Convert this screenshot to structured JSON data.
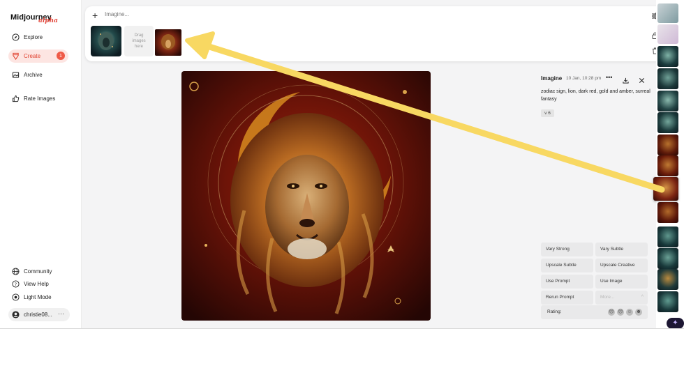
{
  "brand": {
    "name": "Midjourney",
    "sub": "alpha"
  },
  "nav": {
    "explore": "Explore",
    "create": "Create",
    "create_badge": "1",
    "archive": "Archive",
    "rate_images": "Rate Images",
    "community": "Community",
    "view_help": "View Help",
    "light_mode": "Light Mode"
  },
  "user": {
    "name": "christie08...",
    "menu": "···"
  },
  "imagine": {
    "placeholder": "Imagine...",
    "drag_hint": [
      "Drag",
      "images",
      "here"
    ]
  },
  "detail": {
    "title": "Imagine",
    "date": "10 Jan, 10:28 pm",
    "prompt": "zodiac sign, lion, dark red, gold and amber, surreal fantasy",
    "version": "v 6"
  },
  "actions": {
    "vary_strong": "Vary Strong",
    "vary_subtle": "Vary Subtle",
    "upscale_subtle": "Upscale Subtle",
    "upscale_creative": "Upscale Creative",
    "use_prompt": "Use Prompt",
    "use_image": "Use Image",
    "rerun_prompt": "Rerun Prompt",
    "more": "More...",
    "rating": "Rating:"
  },
  "colors": {
    "accent": "#e0402e",
    "arrow": "#f8d862"
  },
  "icons": [
    "explore-icon",
    "create-icon",
    "archive-icon",
    "rate-images-icon",
    "globe-icon",
    "help-icon",
    "sun-icon",
    "avatar-icon",
    "plus-icon",
    "settings-sliders-icon",
    "lock-icon",
    "trash-icon",
    "more-icon",
    "download-icon",
    "close-icon",
    "sparkle-icon"
  ]
}
